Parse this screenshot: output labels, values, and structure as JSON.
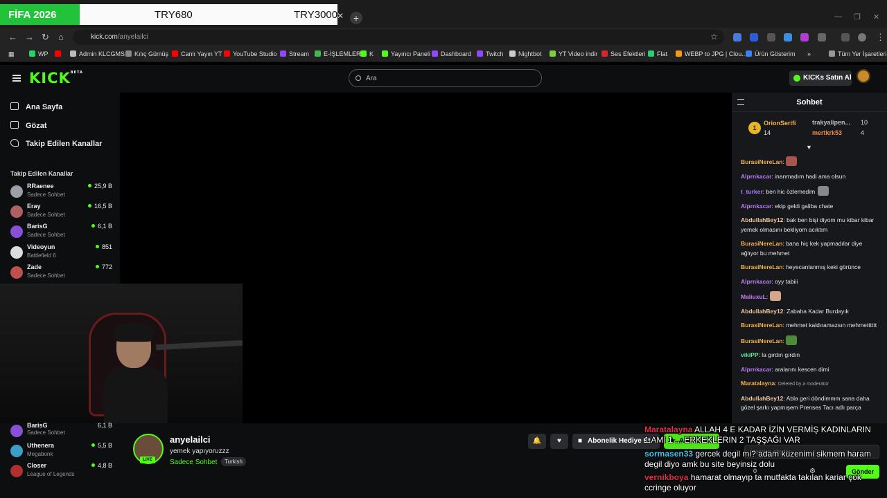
{
  "banner": {
    "left": "FİFA 2026",
    "mid": "TRY680",
    "right": "TRY3000"
  },
  "browser": {
    "url_host": "kick.com",
    "url_path": "/anyelailci"
  },
  "bookmarks": [
    {
      "label": "WP",
      "color": "#25d366"
    },
    {
      "label": "",
      "color": "#ff0000"
    },
    {
      "label": "Admin KLCGMS",
      "color": "#bbbbbb"
    },
    {
      "label": "Kılıç Gümüş",
      "color": "#888888"
    },
    {
      "label": "Canlı Yayın YT",
      "color": "#ff0000"
    },
    {
      "label": "YouTube Studio",
      "color": "#ff0000"
    },
    {
      "label": "Stream",
      "color": "#9146ff"
    },
    {
      "label": "E-İŞLEMLER",
      "color": "#3fb950"
    },
    {
      "label": "K",
      "color": "#53fc18"
    },
    {
      "label": "Yayıncı Paneli",
      "color": "#53fc18"
    },
    {
      "label": "Dashboard",
      "color": "#9146ff"
    },
    {
      "label": "Twitch",
      "color": "#9146ff"
    },
    {
      "label": "Nightbot",
      "color": "#cccccc"
    },
    {
      "label": "YT Video indir",
      "color": "#7ad03a"
    },
    {
      "label": "Ses Efektleri",
      "color": "#d62828"
    },
    {
      "label": "Flat",
      "color": "#2ecc71"
    },
    {
      "label": "WEBP to JPG | Clou...",
      "color": "#f39c12"
    },
    {
      "label": "Ürün Gösterim",
      "color": "#3b82f6"
    },
    {
      "label": "»",
      "color": ""
    },
    {
      "label": "Tüm Yer İşaretleri",
      "color": "#999999"
    }
  ],
  "header": {
    "logo": "KICK",
    "logo_badge": "BETA",
    "search_placeholder": "Ara",
    "buy_label": "KICKs Satın Al"
  },
  "sidebar": {
    "nav": [
      "Ana Sayfa",
      "Gözat",
      "Takip Edilen Kanallar"
    ],
    "section_title": "Takip Edilen Kanallar",
    "channels": [
      {
        "name": "RRaenee",
        "sub": "Sadece Sohbet",
        "viewers": "25,9 B",
        "color": "#9aa0a6"
      },
      {
        "name": "Eray",
        "sub": "Sadece Sohbet",
        "viewers": "16,5 B",
        "color": "#b06060"
      },
      {
        "name": "BarisG",
        "sub": "Sadece Sohbet",
        "viewers": "6,1 B",
        "color": "#8a4fd8"
      },
      {
        "name": "Videoyun",
        "sub": "Battlefield 6",
        "viewers": "851",
        "color": "#dddddd"
      },
      {
        "name": "Zade",
        "sub": "Sadece Sohbet",
        "viewers": "772",
        "color": "#c0504d"
      }
    ],
    "channels_lower": [
      {
        "name": "BarisG",
        "sub": "Sadece Sohbet",
        "viewers": "6,1 B",
        "color": "#8a4fd8"
      },
      {
        "name": "Uthenera",
        "sub": "Megabonk",
        "viewers": "5,5 B",
        "color": "#3aa0c8"
      },
      {
        "name": "Closer",
        "sub": "League of Legends",
        "viewers": "4,8 B",
        "color": "#b03030"
      }
    ]
  },
  "stream": {
    "name": "anyelailci",
    "title": "yemek yapıyoruzzz",
    "category": "Sadece Sohbet",
    "language": "Turkish",
    "live": "LIVE",
    "gift_label": "Abonelik Hediye Et",
    "subscribe_label": "Abone ol"
  },
  "chat": {
    "title": "Sohbet",
    "leaders": [
      {
        "rank": "1",
        "name": "OrionSerifi",
        "count": "14"
      },
      {
        "name": "trakyalipen...",
        "count": "10"
      },
      {
        "name": "mertkrk53",
        "count": "4"
      }
    ],
    "messages": [
      {
        "user": "BurasiNereLan",
        "color": "#f3b34a",
        "text": "",
        "emote": "#a8554a"
      },
      {
        "user": "Alprnkacar",
        "color": "#b77cf0",
        "text": "inanmadım hadi ama olsun"
      },
      {
        "user": "t_turker",
        "color": "#a67cf5",
        "text": "ben hic özlemedim",
        "emote": "#888888"
      },
      {
        "user": "Alprnkacar",
        "color": "#b77cf0",
        "text": "ekip geldi galiba chate"
      },
      {
        "user": "AbdullahBey12",
        "color": "#f0c8a0",
        "text": "bak ben bişi diyom mu kibar kibar yemek olmasını bekliyom acıktım"
      },
      {
        "user": "BurasiNereLan",
        "color": "#f3b34a",
        "text": "bana hiç kek yapmadılar diye ağlıyor bu mehmet"
      },
      {
        "user": "BurasiNereLan",
        "color": "#f3b34a",
        "text": "heyecanlanmış keki görünce"
      },
      {
        "user": "Alprnkacar",
        "color": "#b77cf0",
        "text": "oyy tabiii"
      },
      {
        "user": "MaliuxuL",
        "color": "#c67ef7",
        "text": "",
        "emote": "#d7a58a"
      },
      {
        "user": "AbdullahBey12",
        "color": "#f0c8a0",
        "text": "Zabaha Kadar Burdayık"
      },
      {
        "user": "BurasiNereLan",
        "color": "#f3b34a",
        "text": "mehmet kaldıramazsın mehmetttttt"
      },
      {
        "user": "BurasiNereLan",
        "color": "#f3b34a",
        "text": "",
        "emote": "#4c8b3a"
      },
      {
        "user": "vikiPP",
        "color": "#5ee8a0",
        "text": "la gırdın gırdın"
      },
      {
        "user": "Alprnkacar",
        "color": "#b77cf0",
        "text": "aralarını kescen dimi"
      },
      {
        "user": "Maratalayna",
        "color": "#f3b34a",
        "text": "Deleted by a moderator",
        "deleted": true
      },
      {
        "user": "AbdullahBey12",
        "color": "#f0c8a0",
        "text": "Abla geri döndimmm sana daha gözel şarkı yapmışem Prenses Tacı adlı parça"
      }
    ],
    "input_placeholder": "Mesajını gönder...",
    "send_label": "Gönder",
    "input_count": "0"
  },
  "overlay": [
    {
      "user": "Maratalayna",
      "text": "ALLAH 4 E KADAR İZİN VERMİŞ KADINLARIN"
    },
    {
      "user": "",
      "text": "1 AMI 1 ... ERKEKLERIN 2 TAŞŞAĞI VAR"
    },
    {
      "user": "sormasen33",
      "text": "gercek degil mi? adam kuzenimi sikmem haram"
    },
    {
      "user": "",
      "text": "degil diyo amk bu site beyinsiz dolu"
    },
    {
      "user": "vernikboya",
      "text": "hamarat olmayıp ta mutfakta takılan kariar çok"
    },
    {
      "user": "",
      "text": "ccringe oluyor"
    }
  ]
}
